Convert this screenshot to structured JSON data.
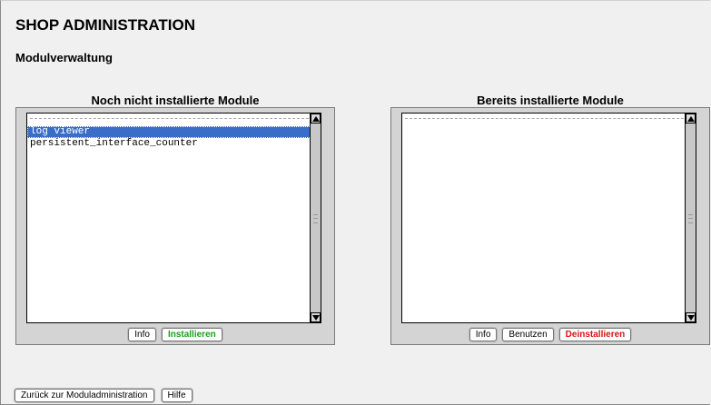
{
  "page": {
    "title": "SHOP ADMINISTRATION",
    "subtitle": "Modulverwaltung"
  },
  "left_panel": {
    "heading": "Noch nicht installierte Module",
    "separator": "----------------------------------------",
    "items": [
      {
        "label": "log viewer",
        "selected": true
      },
      {
        "label": "persistent_interface_counter",
        "selected": false
      }
    ],
    "buttons": {
      "info": "Info",
      "install": "Installieren"
    }
  },
  "right_panel": {
    "heading": "Bereits installierte Module",
    "separator": "----------------------------------------",
    "items": [],
    "buttons": {
      "info": "Info",
      "use": "Benutzen",
      "uninstall": "Deinstallieren"
    }
  },
  "footer": {
    "back_button": "Zurück zur Moduladministration",
    "help_button": "Hilfe"
  },
  "colors": {
    "selection": "#3a6dc8",
    "install_text": "#1aa01a",
    "uninstall_text": "#e01010"
  }
}
